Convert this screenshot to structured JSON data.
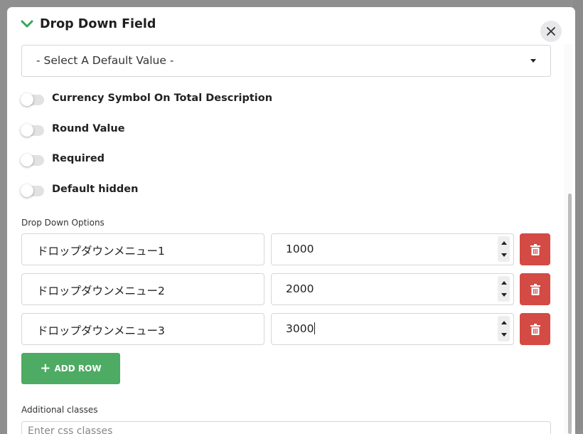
{
  "dialog": {
    "title": "Drop Down Field",
    "close_icon": "close-icon",
    "collapse_icon": "chevron-down-icon",
    "accent_color": "#4dab63"
  },
  "default_select": {
    "value": "- Select A Default Value -"
  },
  "toggles": [
    {
      "label": "Currency Symbol On Total Description",
      "on": false
    },
    {
      "label": "Round Value",
      "on": false
    },
    {
      "label": "Required",
      "on": false
    },
    {
      "label": "Default hidden",
      "on": false
    }
  ],
  "options_section": {
    "label": "Drop Down Options",
    "rows": [
      {
        "name": "ドロップダウンメニュー1",
        "value": "1000"
      },
      {
        "name": "ドロップダウンメニュー2",
        "value": "2000"
      },
      {
        "name": "ドロップダウンメニュー3",
        "value": "3000"
      }
    ],
    "delete_color": "#d44a44",
    "delete_icon": "trash-icon"
  },
  "add_row": {
    "label": "ADD ROW",
    "icon": "plus-icon"
  },
  "additional_classes": {
    "label": "Additional classes",
    "placeholder": "Enter css classes"
  }
}
